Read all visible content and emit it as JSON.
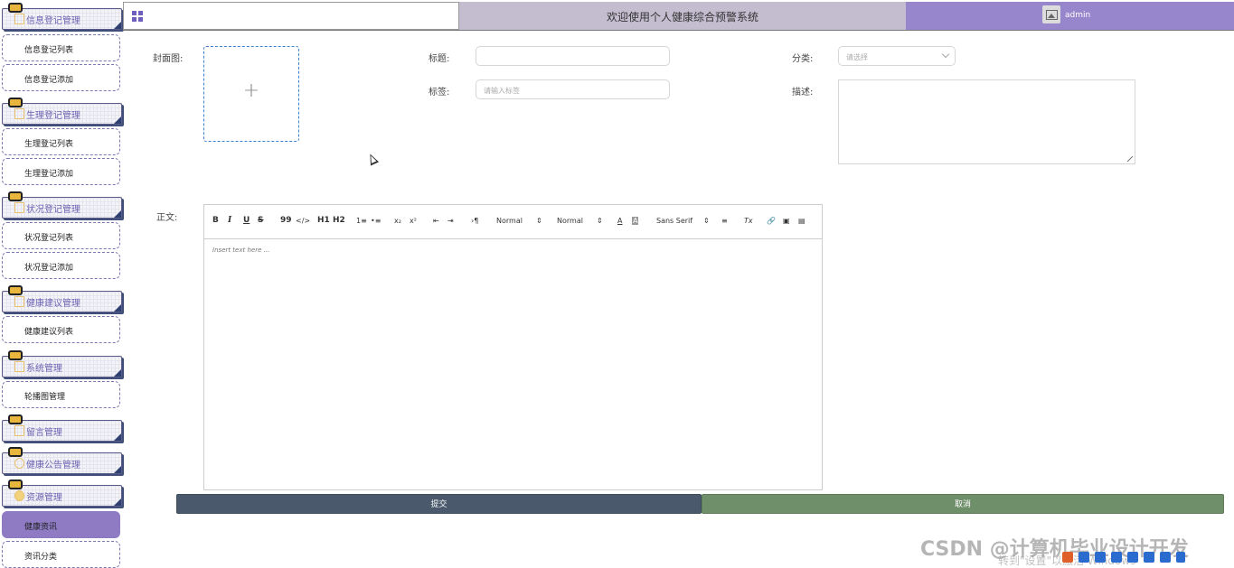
{
  "sidebar": {
    "groups": [
      {
        "label": "信息登记管理",
        "items": [
          "信息登记列表",
          "信息登记添加"
        ]
      },
      {
        "label": "生理登记管理",
        "items": [
          "生理登记列表",
          "生理登记添加"
        ]
      },
      {
        "label": "状况登记管理",
        "items": [
          "状况登记列表",
          "状况登记添加"
        ]
      },
      {
        "label": "健康建议管理",
        "items": [
          "健康建议列表"
        ]
      },
      {
        "label": "系统管理",
        "items": [
          "轮播图管理"
        ]
      },
      {
        "label": "留言管理",
        "items": []
      },
      {
        "label": "健康公告管理",
        "items": []
      },
      {
        "label": "资源管理",
        "items": [
          "健康资讯",
          "资讯分类"
        ]
      }
    ]
  },
  "header": {
    "title": "欢迎使用个人健康综合预警系统",
    "username": "admin"
  },
  "form": {
    "cover_label": "封面图:",
    "upload_plus": "+",
    "title_label": "标题:",
    "title_value": "",
    "category_label": "分类:",
    "category_placeholder": "请选择",
    "tags_label": "标签:",
    "tags_placeholder": "请输入标签",
    "desc_label": "描述:",
    "content_label": "正文:"
  },
  "editor": {
    "bold": "B",
    "italic": "I",
    "underline": "U",
    "strike": "S",
    "quote": "99",
    "code": "</>",
    "h1": "H1",
    "h2": "H2",
    "ordered_list": "1≡",
    "bullet_list": "•≡",
    "subscript": "x₂",
    "superscript": "x²",
    "outdent": "⇤",
    "indent": "⇥",
    "direction": "›¶",
    "size_select": "Normal",
    "header_select": "Normal",
    "font_color": "A",
    "background": "A",
    "font_select": "Sans Serif",
    "align": "≡",
    "clean": "Tx",
    "link": "🔗",
    "image": "▣",
    "video": "▤",
    "placeholder": "Insert text here ..."
  },
  "actions": {
    "submit_label": "提交",
    "cancel_label": "取消"
  },
  "watermark": {
    "main": "CSDN @计算机毕业设计开发",
    "sub": "转到\"设置\"以激活 Windows"
  },
  "colors": {
    "accent": "#8e7bc4",
    "header_mid": "#c4bdd0",
    "header_right": "#9886cc",
    "submit": "#4a5a6c",
    "cancel": "#6f8e6a"
  }
}
